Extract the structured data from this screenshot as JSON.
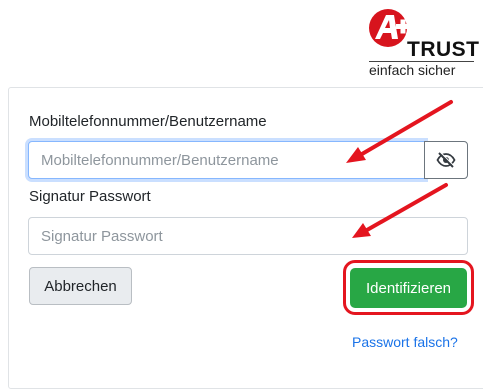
{
  "logo": {
    "brand": "TRUST",
    "tagline": "einfach sicher"
  },
  "form": {
    "username_label": "Mobiltelefonnummer/Benutzername",
    "username_placeholder": "Mobiltelefonnummer/Benutzername",
    "username_value": "",
    "password_label": "Signatur Passwort",
    "password_placeholder": "Signatur Passwort",
    "password_value": "",
    "cancel_label": "Abbrechen",
    "submit_label": "Identifizieren",
    "forgot_label": "Passwort falsch?"
  },
  "icons": {
    "toggle_visibility": "eye-slash-icon",
    "logo_mark": "a-logo-icon",
    "annotation": "red-arrow-icon"
  },
  "colors": {
    "primary": "#28a745",
    "annotation": "#e4151f",
    "link": "#1a73e8"
  }
}
